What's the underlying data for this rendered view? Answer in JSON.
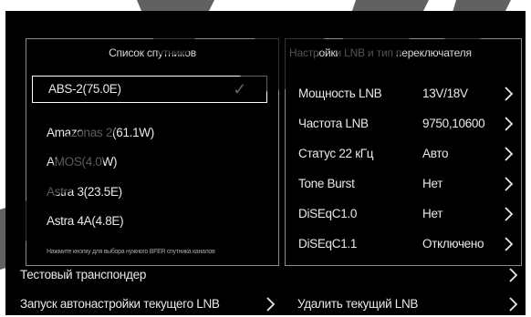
{
  "satellite_list": {
    "title": "Список спутников",
    "items": [
      {
        "label": "ABS-2(75.0E)",
        "selected": true
      },
      {
        "label": "Amazonas 2(61.1W)"
      },
      {
        "label": "AMOS(4.0W)"
      },
      {
        "label": "Astra 3(23.5E)"
      },
      {
        "label": "Astra 4A(4.8E)"
      }
    ],
    "check_glyph": "✓",
    "hint": "Нажмите кнопку для выбора нужного BFER спутника каналов"
  },
  "lnb_settings": {
    "title": "Настройки LNB и тип переключателя",
    "rows": [
      {
        "label": "Мощность LNB",
        "value": "13V/18V"
      },
      {
        "label": "Частота LNB",
        "value": "9750,10600"
      },
      {
        "label": "Статус 22 кГц",
        "value": "Авто"
      },
      {
        "label": "Tone Burst",
        "value": "Нет"
      },
      {
        "label": "DiSEqC1.0",
        "value": "Нет"
      },
      {
        "label": "DiSEqC1.1",
        "value": "Отключено"
      }
    ]
  },
  "bottom": {
    "test_transponder": "Тестовый транспондер",
    "autoscan": "Запуск автонастройки текущего LNB",
    "delete_lnb": "Удалить текущий LNB"
  },
  "icons": {
    "chevron": "chevron-right-icon",
    "check": "checkmark-icon"
  },
  "colors": {
    "background": "#000000",
    "text": "#e9e9e9",
    "border": "#8c8c8c",
    "watermark": "#000000"
  }
}
